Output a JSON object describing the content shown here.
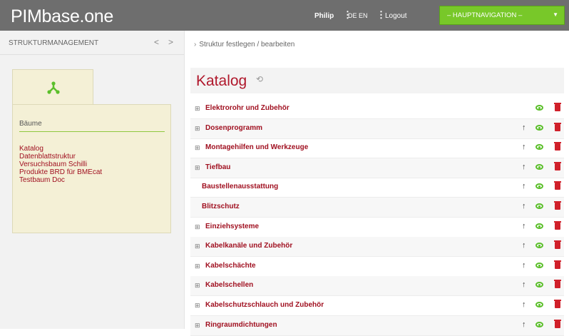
{
  "header": {
    "logo": "PIMbase.one",
    "user": "Philip",
    "lang_de": "DE",
    "lang_en": "EN",
    "logout": "Logout",
    "main_nav": "– HAUPTNAVIGATION –"
  },
  "sidebar": {
    "title": "STRUKTURMANAGEMENT",
    "nav_prev": "<",
    "nav_next": ">",
    "section": "Bäume",
    "trees": [
      "Katalog",
      "Datenblattstruktur",
      "Versuchsbaum Schilli",
      "Produkte BRD für BMEcat",
      "Testbaum Doc"
    ]
  },
  "main": {
    "breadcrumb": "Struktur festlegen / bearbeiten",
    "title": "Katalog",
    "rows": [
      {
        "label": "Elektrorohr und Zubehör",
        "expandable": true,
        "up": false
      },
      {
        "label": "Dosenprogramm",
        "expandable": true,
        "up": true
      },
      {
        "label": "Montagehilfen und Werkzeuge",
        "expandable": true,
        "up": true
      },
      {
        "label": "Tiefbau",
        "expandable": true,
        "up": true
      },
      {
        "label": "Baustellenausstattung",
        "expandable": false,
        "up": true
      },
      {
        "label": "Blitzschutz",
        "expandable": false,
        "up": true
      },
      {
        "label": "Einziehsysteme",
        "expandable": true,
        "up": true
      },
      {
        "label": "Kabelkanäle und Zubehör",
        "expandable": true,
        "up": true
      },
      {
        "label": "Kabelschächte",
        "expandable": true,
        "up": true
      },
      {
        "label": "Kabelschellen",
        "expandable": true,
        "up": true
      },
      {
        "label": "Kabelschutzschlauch und Zubehör",
        "expandable": true,
        "up": true
      },
      {
        "label": "Ringraumdichtungen",
        "expandable": true,
        "up": true
      }
    ]
  },
  "colors": {
    "accent": "#78c829",
    "brand_red": "#a01020",
    "header_bg": "#6e6e6e",
    "panel_bg": "#f4f0d6"
  }
}
